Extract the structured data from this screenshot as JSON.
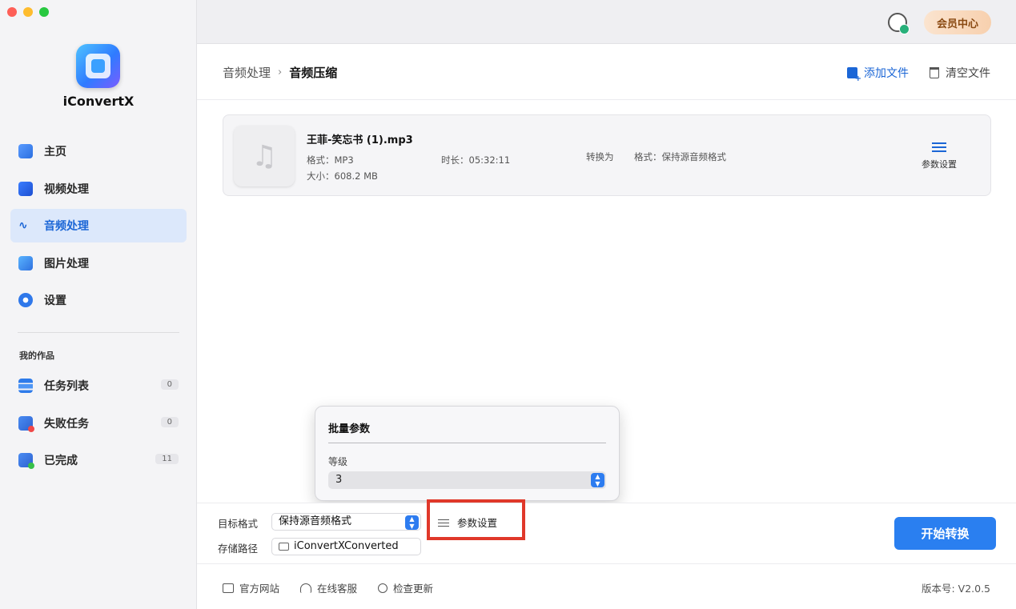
{
  "window": {
    "app_name": "iConvertX"
  },
  "sidebar": {
    "items": [
      {
        "label": "主页",
        "icon": "home-icon"
      },
      {
        "label": "视频处理",
        "icon": "video-icon"
      },
      {
        "label": "音频处理",
        "icon": "audio-wave-icon",
        "active": true
      },
      {
        "label": "图片处理",
        "icon": "image-icon"
      },
      {
        "label": "设置",
        "icon": "gear-icon"
      }
    ],
    "section_label": "我的作品",
    "works": [
      {
        "label": "任务列表",
        "count": "0",
        "icon": "task-list-icon"
      },
      {
        "label": "失败任务",
        "count": "0",
        "icon": "failed-task-icon"
      },
      {
        "label": "已完成",
        "count": "11",
        "icon": "completed-icon"
      }
    ]
  },
  "topbar": {
    "member_label": "会员中心"
  },
  "header": {
    "breadcrumb_parent": "音频处理",
    "breadcrumb_sep": "›",
    "breadcrumb_current": "音频压缩",
    "add_file": "添加文件",
    "clear_files": "清空文件"
  },
  "file": {
    "name": "王菲-笑忘书 (1).mp3",
    "format": "格式：MP3",
    "size": "大小：608.2 MB",
    "duration": "时长：05:32:11",
    "convert_to": "转换为",
    "target_format": "格式：保持源音频格式",
    "params_label": "参数设置"
  },
  "popover": {
    "title": "批量参数",
    "level_label": "等级",
    "level_value": "3"
  },
  "bottom": {
    "target_format_label": "目标格式",
    "target_format_value": "保持源音频格式",
    "params_label": "参数设置",
    "save_path_label": "存储路径",
    "save_path_value": "iConvertXConverted",
    "start_label": "开始转换"
  },
  "footer": {
    "website": "官方网站",
    "support": "在线客服",
    "update": "检查更新",
    "version": "版本号:  V2.0.5"
  },
  "colors": {
    "accent": "#2a7ff0",
    "highlight_border": "#e0382a",
    "member_text": "#8a4a12"
  }
}
